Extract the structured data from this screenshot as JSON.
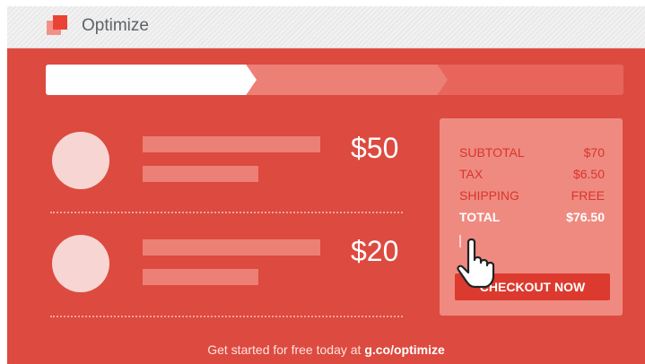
{
  "header": {
    "brand": "Optimize",
    "logo_icon": "optimize-logo-icon"
  },
  "progress": {
    "steps_total": 3,
    "current_step": 1
  },
  "cart": {
    "items": [
      {
        "price": "$50"
      },
      {
        "price": "$20"
      }
    ]
  },
  "summary": {
    "subtotal_label": "SUBTOTAL",
    "subtotal_value": "$70",
    "tax_label": "TAX",
    "tax_value": "$6.50",
    "shipping_label": "SHIPPING",
    "shipping_value": "FREE",
    "total_label": "TOTAL",
    "total_value": "$76.50",
    "checkout_label": "CHECKOUT NOW"
  },
  "footer": {
    "text": "Get started for free today at ",
    "link": "g.co/optimize"
  },
  "colors": {
    "brand_red": "#dd4a3f",
    "button_red": "#dc3a2e",
    "panel": "#ef8a81"
  }
}
